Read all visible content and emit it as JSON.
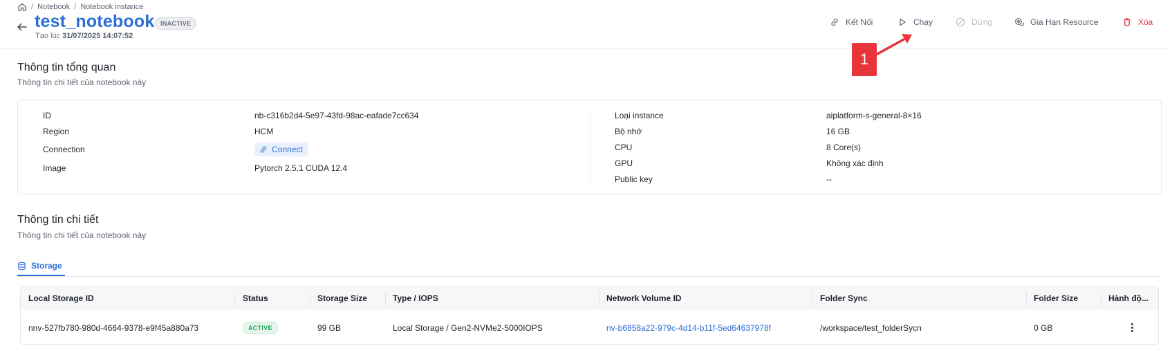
{
  "breadcrumb": {
    "items": [
      "Notebook",
      "Notebook instance"
    ],
    "separator": "/"
  },
  "header": {
    "title": "test_notebook",
    "status": "INACTIVE",
    "created_label": "Tạo lúc",
    "created_value": "31/07/2025 14:07:52"
  },
  "actions": {
    "connect": "Kết Nối",
    "run": "Chạy",
    "stop": "Dừng",
    "extend": "Gia Hạn Resource",
    "delete": "Xóa"
  },
  "annotation": {
    "label": "1"
  },
  "overview": {
    "title": "Thông tin tổng quan",
    "subtitle": "Thông tin chi tiết của notebook này",
    "left": [
      {
        "label": "ID",
        "value": "nb-c316b2d4-5e97-43fd-98ac-eafade7cc634"
      },
      {
        "label": "Region",
        "value": "HCM"
      },
      {
        "label": "Connection",
        "value": "Connect"
      },
      {
        "label": "Image",
        "value": "Pytorch 2.5.1 CUDA 12.4"
      }
    ],
    "right": [
      {
        "label": "Loại instance",
        "value": "aiplatform-s-general-8×16"
      },
      {
        "label": "Bộ nhớ",
        "value": "16 GB"
      },
      {
        "label": "CPU",
        "value": "8 Core(s)"
      },
      {
        "label": "GPU",
        "value": "Không xác định"
      },
      {
        "label": "Public key",
        "value": "--"
      }
    ]
  },
  "details": {
    "title": "Thông tin chi tiết",
    "subtitle": "Thông tin chi tiết của notebook này",
    "tab_label": "Storage"
  },
  "storage_table": {
    "columns": [
      "Local Storage ID",
      "Status",
      "Storage Size",
      "Type / IOPS",
      "Network Volume ID",
      "Folder Sync",
      "Folder Size",
      "Hành độ..."
    ],
    "rows": [
      {
        "local_storage_id": "nnv-527fb780-980d-4664-9378-e9f45a880a73",
        "status": "ACTIVE",
        "storage_size": "99 GB",
        "type_iops": "Local Storage / Gen2-NVMe2-5000IOPS",
        "network_volume_id": "nv-b6858a22-979c-4d14-b11f-5ed64637978f",
        "folder_sync": "/workspace/test_folderSycn",
        "folder_size": "0 GB"
      }
    ]
  },
  "colors": {
    "accent": "#2b6fd6",
    "danger": "#e5353b",
    "success": "#16a34a",
    "annotation": "#e8353b"
  },
  "icons": [
    "home-icon",
    "back-arrow-icon",
    "link-icon",
    "play-icon",
    "ban-icon",
    "settings-refresh-icon",
    "trash-icon",
    "database-icon",
    "kebab-menu-icon"
  ]
}
